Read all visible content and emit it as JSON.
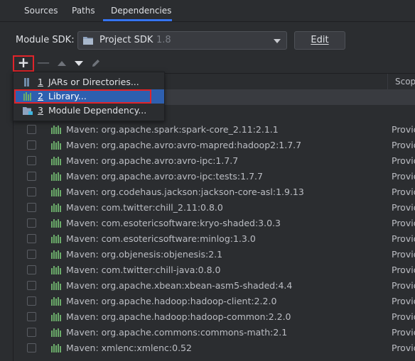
{
  "tabs": [
    {
      "label": "Sources"
    },
    {
      "label": "Paths"
    },
    {
      "label": "Dependencies"
    }
  ],
  "sdk": {
    "label": "Module SDK:",
    "value": "Project SDK",
    "version": "1.8",
    "edit_label": "Edit"
  },
  "toolbar": {
    "add": "+",
    "remove": "—"
  },
  "table": {
    "scope_header": "Scope",
    "rows": [
      {
        "name": "Maven: org.apache.spark:spark-core_2.11:2.1.1",
        "scope": "Provided"
      },
      {
        "name": "Maven: org.apache.avro:avro-mapred:hadoop2:1.7.7",
        "scope": "Provided"
      },
      {
        "name": "Maven: org.apache.avro:avro-ipc:1.7.7",
        "scope": "Provided"
      },
      {
        "name": "Maven: org.apache.avro:avro-ipc:tests:1.7.7",
        "scope": "Provided"
      },
      {
        "name": "Maven: org.codehaus.jackson:jackson-core-asl:1.9.13",
        "scope": "Provided"
      },
      {
        "name": "Maven: com.twitter:chill_2.11:0.8.0",
        "scope": "Provided"
      },
      {
        "name": "Maven: com.esotericsoftware:kryo-shaded:3.0.3",
        "scope": "Provided"
      },
      {
        "name": "Maven: com.esotericsoftware:minlog:1.3.0",
        "scope": "Provided"
      },
      {
        "name": "Maven: org.objenesis:objenesis:2.1",
        "scope": "Provided"
      },
      {
        "name": "Maven: com.twitter:chill-java:0.8.0",
        "scope": "Provided"
      },
      {
        "name": "Maven: org.apache.xbean:xbean-asm5-shaded:4.4",
        "scope": "Provided"
      },
      {
        "name": "Maven: org.apache.hadoop:hadoop-client:2.2.0",
        "scope": "Provided"
      },
      {
        "name": "Maven: org.apache.hadoop:hadoop-common:2.2.0",
        "scope": "Provided"
      },
      {
        "name": "Maven: org.apache.commons:commons-math:2.1",
        "scope": "Provided"
      },
      {
        "name": "Maven: xmlenc:xmlenc:0.52",
        "scope": "Provided"
      }
    ]
  },
  "popup": {
    "items": [
      {
        "num": "1",
        "label": "JARs or Directories...",
        "icon": "jar-directory-icon"
      },
      {
        "num": "2",
        "label": "Library...",
        "icon": "library-icon"
      },
      {
        "num": "3",
        "label": "Module Dependency...",
        "icon": "module-icon"
      }
    ],
    "selected_index": 1
  },
  "colors": {
    "background": "#2b2d30",
    "accent": "#3574f0",
    "selection": "#2e5faf",
    "highlight_box": "#e0242a",
    "library_icon": "#6bab6a"
  }
}
